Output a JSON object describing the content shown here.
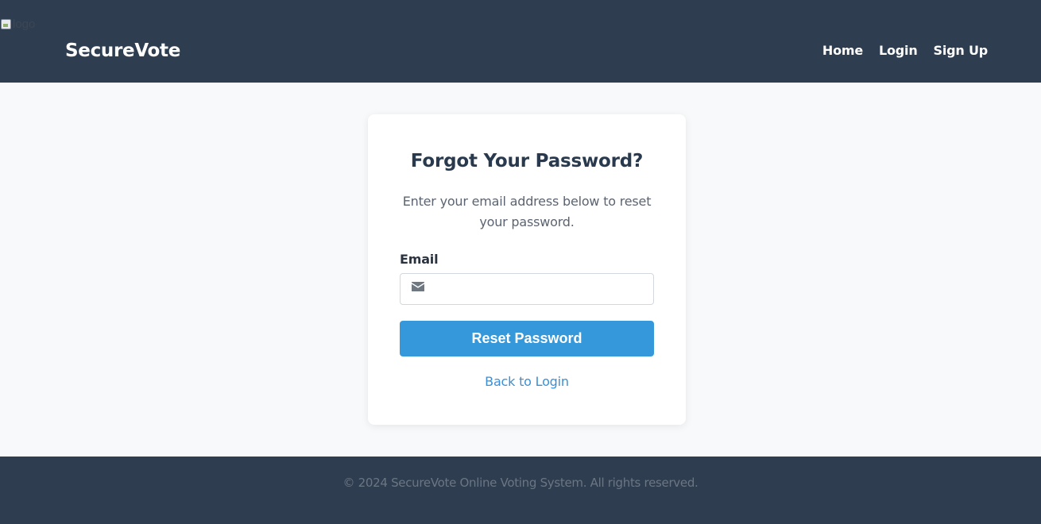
{
  "header": {
    "logo_alt": "logo",
    "brand": "SecureVote",
    "nav": [
      {
        "label": "Home"
      },
      {
        "label": "Login"
      },
      {
        "label": "Sign Up"
      }
    ]
  },
  "card": {
    "title": "Forgot Your Password?",
    "subtitle": "Enter your email address below to reset your password.",
    "email_label": "Email",
    "email_value": "",
    "email_icon": "envelope-icon",
    "button_label": "Reset Password",
    "back_link": "Back to Login"
  },
  "footer": {
    "text": "© 2024 SecureVote Online Voting System. All rights reserved."
  },
  "colors": {
    "header_bg": "#2e3d50",
    "accent": "#3498db",
    "link": "#3a8fd6"
  }
}
